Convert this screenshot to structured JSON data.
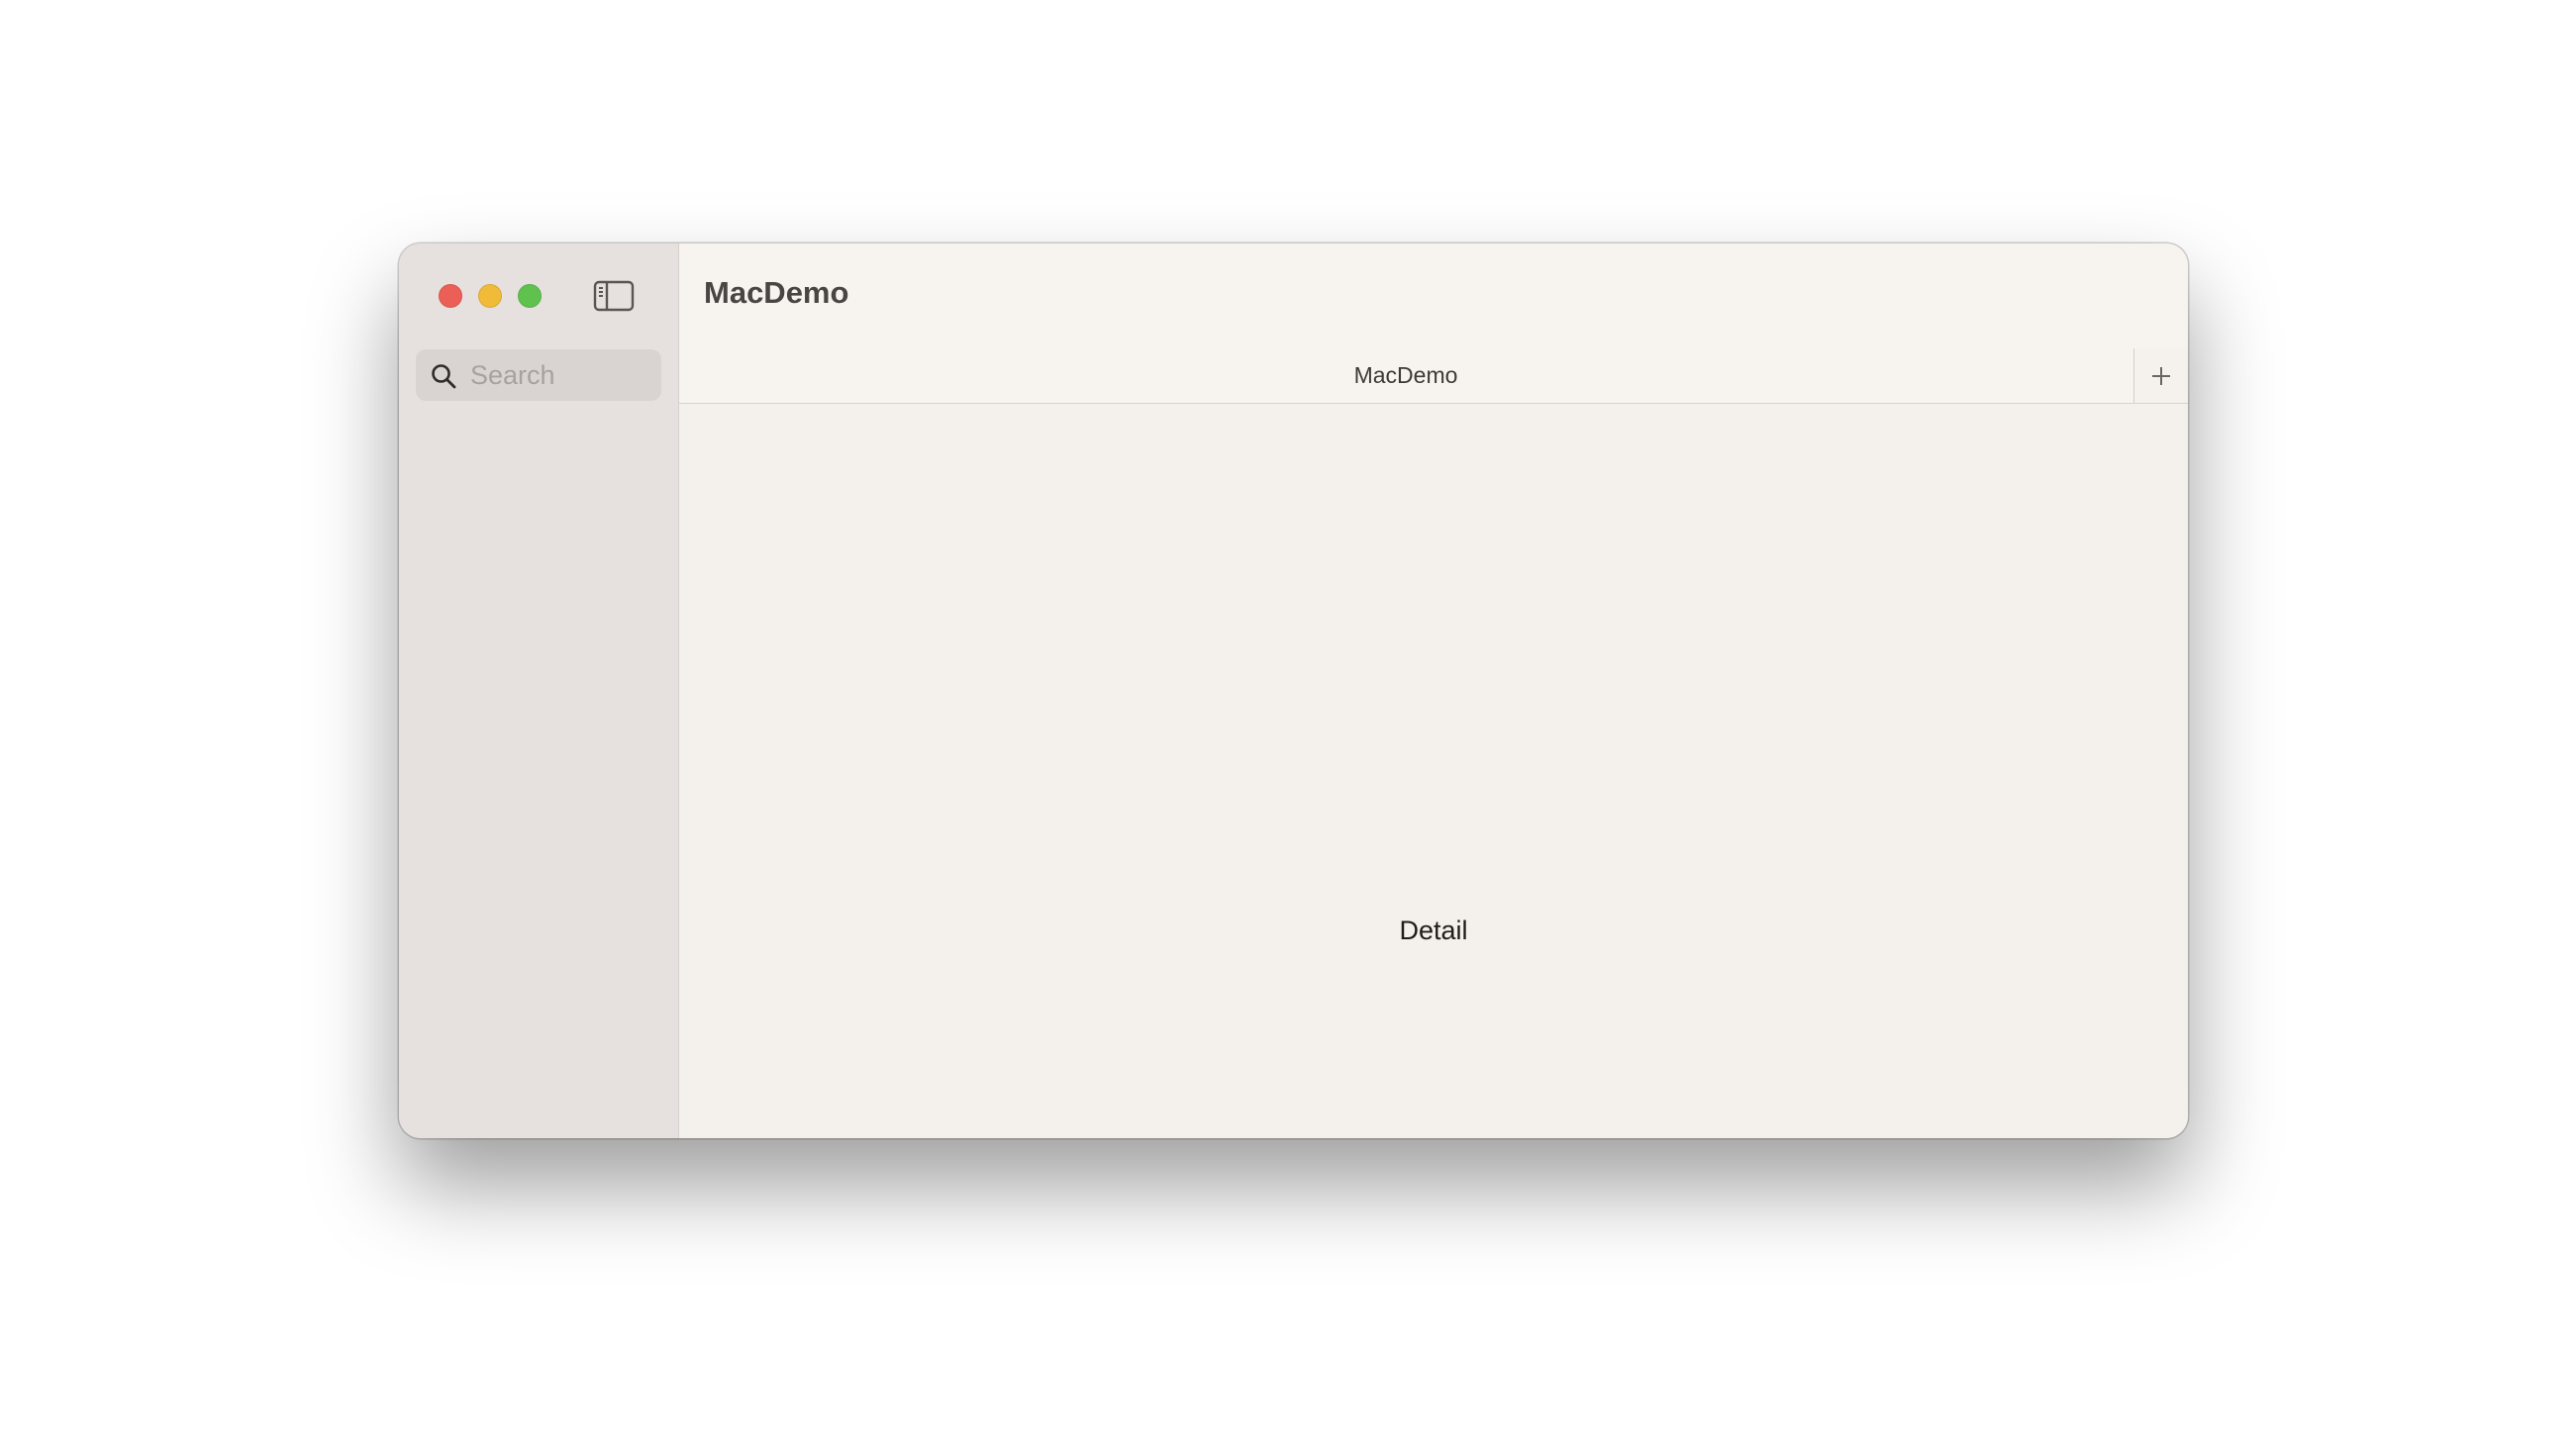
{
  "window": {
    "title": "MacDemo"
  },
  "sidebar": {
    "search": {
      "placeholder": "Search",
      "value": ""
    },
    "items": []
  },
  "tabbar": {
    "tabs": [
      {
        "label": "MacDemo",
        "active": true
      }
    ]
  },
  "detail": {
    "text": "Detail"
  },
  "colors": {
    "close": "#ec5f56",
    "minimize": "#f1bb3a",
    "zoom": "#5fc24f",
    "sidebar_bg": "#e6e1de",
    "content_bg": "#f4f0eb"
  },
  "icons": {
    "sidebar_toggle": "sidebar-toggle-icon",
    "search": "search-icon",
    "new_tab": "plus-icon"
  }
}
